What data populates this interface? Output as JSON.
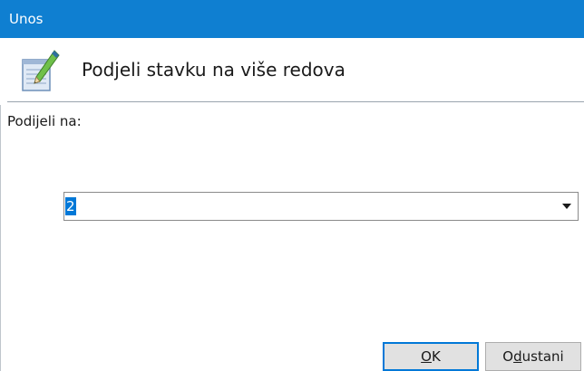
{
  "window": {
    "title": "Unos"
  },
  "header": {
    "icon": "pencil-notepad-icon",
    "heading": "Podjeli stavku na više redova"
  },
  "form": {
    "label": "Podijeli na:",
    "combo_value": "2",
    "combo_arrow_icon": "dropdown-arrow-icon"
  },
  "buttons": {
    "ok_mnemonic": "O",
    "ok_rest": "K",
    "cancel_prefix": "O",
    "cancel_mnemonic": "d",
    "cancel_rest": "ustani"
  },
  "colors": {
    "titlebar": "#0f7fd1",
    "selection": "#0078d7",
    "default_button_border": "#0078d7"
  }
}
